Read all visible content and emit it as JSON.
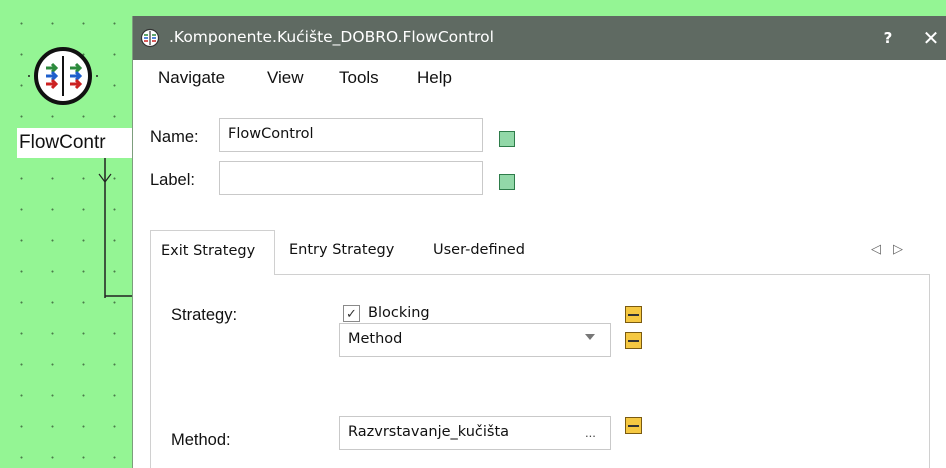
{
  "canvas": {
    "component_label": "FlowContr",
    "component_icon": "flow-control-icon"
  },
  "dialog": {
    "title": ".Komponente.Kućište_DOBRO.FlowControl",
    "help_label": "?",
    "close_label": "✕"
  },
  "menu": {
    "items": [
      "Navigate",
      "View",
      "Tools",
      "Help"
    ]
  },
  "form": {
    "name_label": "Name:",
    "name_value": "FlowControl",
    "label_label": "Label:",
    "label_value": ""
  },
  "tabs": {
    "items": [
      "Exit Strategy",
      "Entry Strategy",
      "User-defined"
    ],
    "active": "Exit Strategy",
    "prev_arrow": "◁",
    "next_arrow": "▷"
  },
  "exit_strategy": {
    "strategy_label": "Strategy:",
    "blocking_label": "Blocking",
    "blocking_checked": true,
    "check_glyph": "✓",
    "select_value": "Method",
    "method_label": "Method:",
    "method_value": "Razvrstavanje_kučišta",
    "browse_label": "..."
  },
  "colors": {
    "canvas_bg": "#94f594",
    "titlebar_bg": "#5f6a62",
    "indicator_green": "#92d8a8",
    "indicator_yellow": "#f5c842"
  }
}
